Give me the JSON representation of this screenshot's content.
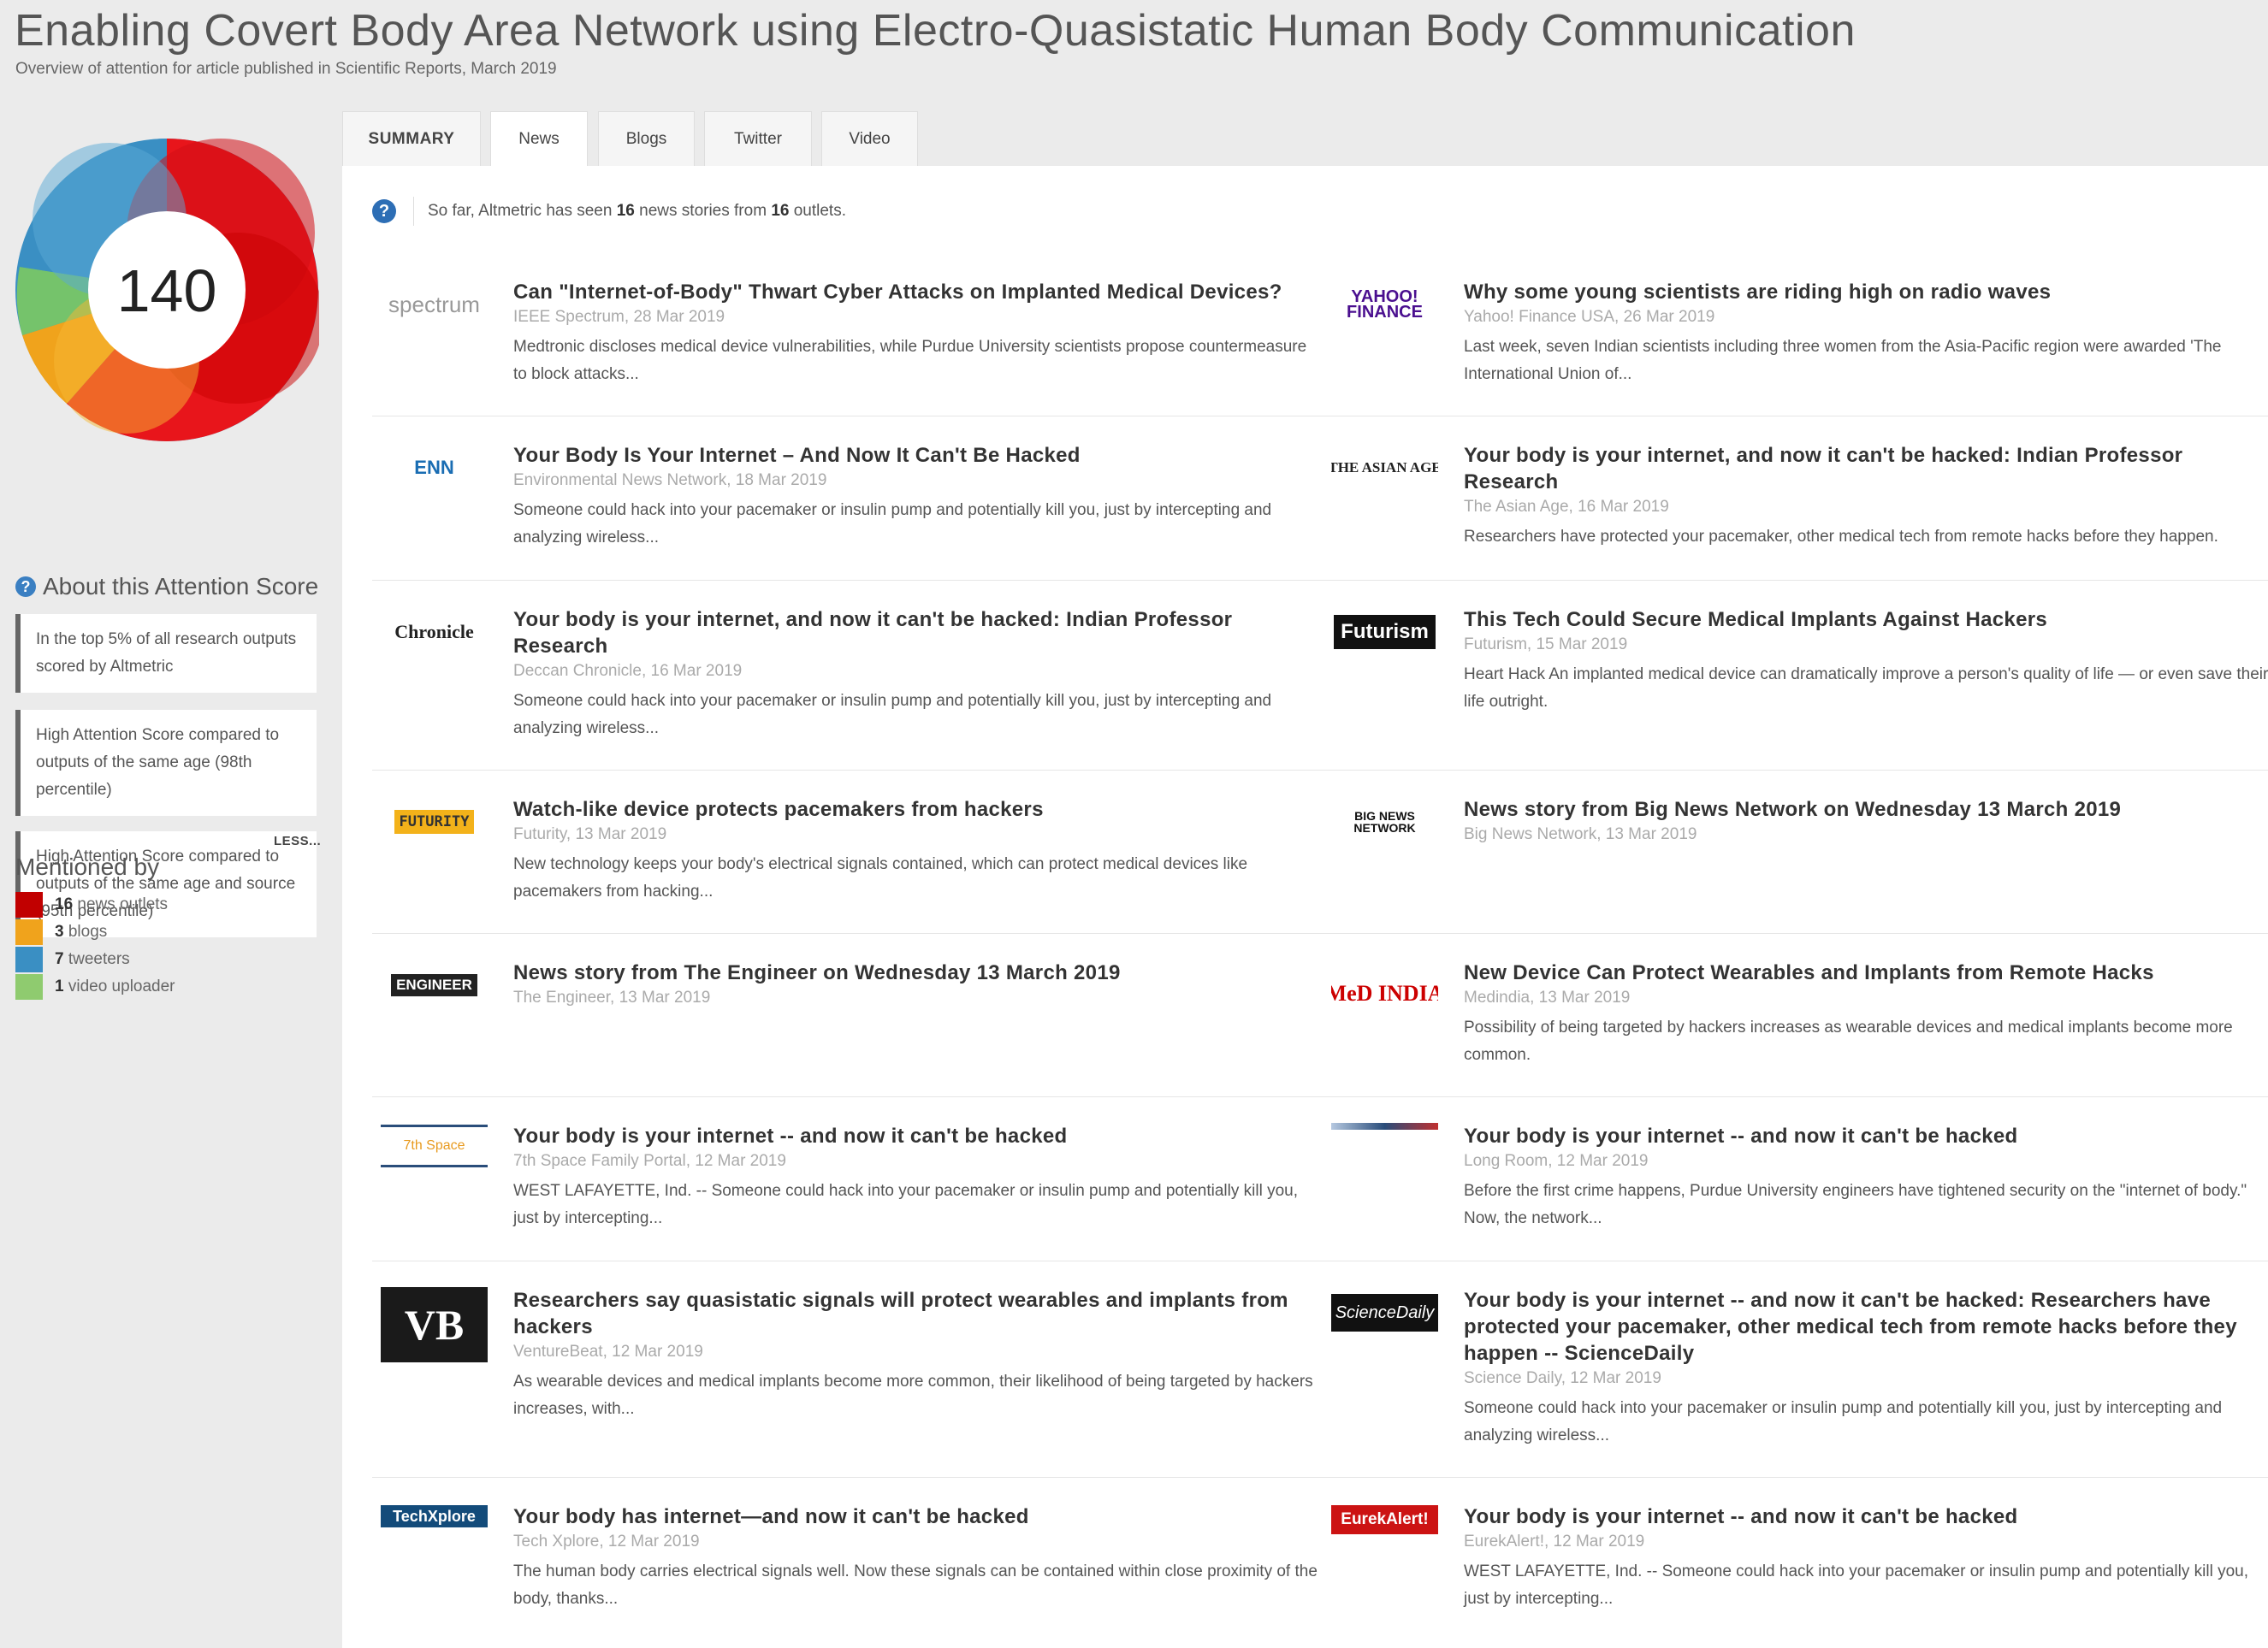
{
  "page": {
    "title": "Enabling Covert Body Area Network using Electro-Quasistatic Human Body Communication",
    "subtitle": "Overview of attention for article published in Scientific Reports, March 2019"
  },
  "score": {
    "value": "140",
    "colors": [
      "#e8151b",
      "#f0a31c",
      "#75c36b",
      "#3a8fc3",
      "#cc0000"
    ]
  },
  "about": {
    "title": "About this Attention Score",
    "boxes": [
      "In the top 5% of all research outputs scored by Altmetric",
      "High Attention Score compared to outputs of the same age (98th percentile)",
      "High Attention Score compared to outputs of the same age and source (95th percentile)"
    ],
    "less_label": "LESS..."
  },
  "mentioned": {
    "title": "Mentioned by",
    "rows": [
      {
        "count": "16",
        "label": "news outlets",
        "color": "#c10000"
      },
      {
        "count": "3",
        "label": "blogs",
        "color": "#f0a31c"
      },
      {
        "count": "7",
        "label": "tweeters",
        "color": "#3a8fc3"
      },
      {
        "count": "1",
        "label": "video uploader",
        "color": "#8fcb6f"
      }
    ]
  },
  "tabs": [
    "SUMMARY",
    "News",
    "Blogs",
    "Twitter",
    "Video"
  ],
  "info": {
    "prefix": "So far, Altmetric has seen",
    "stories": "16",
    "middle": "news stories from",
    "outlets": "16",
    "suffix": "outlets."
  },
  "stories": [
    {
      "logo": "spectrum",
      "headline": "Can \"Internet-of-Body\" Thwart Cyber Attacks on Implanted Medical Devices?",
      "meta": "IEEE Spectrum, 28 Mar 2019",
      "desc": "Medtronic discloses medical device vulnerabilities, while Purdue University scientists propose countermeasure to block attacks..."
    },
    {
      "logo": "YAHOO! FINANCE",
      "headline": "Why some young scientists are riding high on radio waves",
      "meta": "Yahoo! Finance USA, 26 Mar 2019",
      "desc": "Last week, seven Indian scientists including three women from the Asia-Pacific region were awarded 'The International Union of..."
    },
    {
      "logo": "ENN",
      "headline": "Your Body Is Your Internet – And Now It Can't Be Hacked",
      "meta": "Environmental News Network, 18 Mar 2019",
      "desc": "Someone could hack into your pacemaker or insulin pump and potentially kill you, just by intercepting and analyzing wireless..."
    },
    {
      "logo": "THE ASIAN AGE",
      "headline": "Your body is your internet, and now it can't be hacked: Indian Professor Research",
      "meta": "The Asian Age, 16 Mar 2019",
      "desc": "Researchers have protected your pacemaker, other medical tech from remote hacks before they happen."
    },
    {
      "logo": "Chronicle",
      "headline": "Your body is your internet, and now it can't be hacked: Indian Professor Research",
      "meta": "Deccan Chronicle, 16 Mar 2019",
      "desc": "Someone could hack into your pacemaker or insulin pump and potentially kill you, just by intercepting and analyzing wireless..."
    },
    {
      "logo": "Futurism",
      "headline": "This Tech Could Secure Medical Implants Against Hackers",
      "meta": "Futurism, 15 Mar 2019",
      "desc": "Heart Hack An implanted medical device can dramatically improve a person's quality of life — or even save their life outright."
    },
    {
      "logo": "FUTURITY",
      "headline": "Watch-like device protects pacemakers from hackers",
      "meta": "Futurity, 13 Mar 2019",
      "desc": "New technology keeps your body's electrical signals contained, which can protect medical devices like pacemakers from hacking..."
    },
    {
      "logo": "BIG NEWS NETWORK",
      "headline": "News story from Big News Network on Wednesday 13 March 2019",
      "meta": "Big News Network, 13 Mar 2019",
      "desc": ""
    },
    {
      "logo": "ENGINEER",
      "headline": "News story from The Engineer on Wednesday 13 March 2019",
      "meta": "The Engineer, 13 Mar 2019",
      "desc": ""
    },
    {
      "logo": "MeD INDIA",
      "headline": "New Device Can Protect Wearables and Implants from Remote Hacks",
      "meta": "Medindia, 13 Mar 2019",
      "desc": "Possibility of being targeted by hackers increases as wearable devices and medical implants become more common."
    },
    {
      "logo": "7th Space",
      "headline": "Your body is your internet -- and now it can't be hacked",
      "meta": "7th Space Family Portal, 12 Mar 2019",
      "desc": "WEST LAFAYETTE, Ind. -- Someone could hack into your pacemaker or insulin pump and potentially kill you, just by intercepting..."
    },
    {
      "logo": "longroom",
      "headline": "Your body is your internet -- and now it can't be hacked",
      "meta": "Long Room, 12 Mar 2019",
      "desc": "Before the first crime happens, Purdue University engineers have tightened security on the \"internet of body.\" Now, the network..."
    },
    {
      "logo": "VB",
      "headline": "Researchers say quasistatic signals will protect wearables and implants from hackers",
      "meta": "VentureBeat, 12 Mar 2019",
      "desc": "As wearable devices and medical implants become more common, their likelihood of being targeted by hackers increases, with..."
    },
    {
      "logo": "ScienceDaily",
      "headline": "Your body is your internet -- and now it can't be hacked: Researchers have protected your pacemaker, other medical tech from remote hacks before they happen -- ScienceDaily",
      "meta": "Science Daily, 12 Mar 2019",
      "desc": "Someone could hack into your pacemaker or insulin pump and potentially kill you, just by intercepting and analyzing wireless..."
    },
    {
      "logo": "TechXplore",
      "headline": "Your body has internet—and now it can't be hacked",
      "meta": "Tech Xplore, 12 Mar 2019",
      "desc": "The human body carries electrical signals well. Now these signals can be contained within close proximity of the body, thanks..."
    },
    {
      "logo": "EurekAlert!",
      "headline": "Your body is your internet -- and now it can't be hacked",
      "meta": "EurekAlert!, 12 Mar 2019",
      "desc": "WEST LAFAYETTE, Ind. -- Someone could hack into your pacemaker or insulin pump and potentially kill you, just by intercepting..."
    }
  ]
}
